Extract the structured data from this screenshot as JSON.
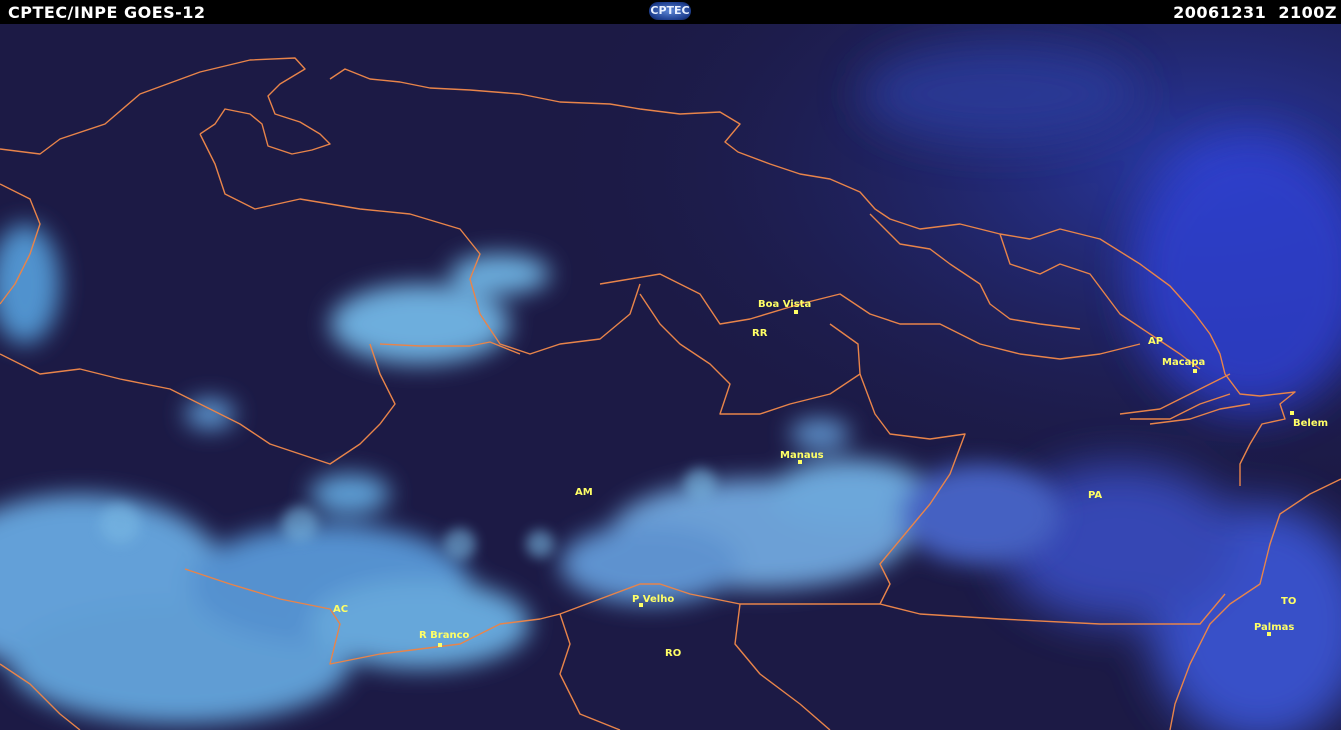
{
  "header": {
    "title": "CPTEC/INPE GOES-12",
    "datetime": "20061231  2100Z",
    "logo_text": "CPTEC"
  },
  "colors": {
    "background": "#1c1a45",
    "clouds": "#7ad0ff",
    "borders": "#e8844a",
    "labels": "#ffff66"
  },
  "cities": [
    {
      "id": "boa-vista",
      "name": "Boa Vista"
    },
    {
      "id": "macapa",
      "name": "Macapa"
    },
    {
      "id": "belem",
      "name": "Belem"
    },
    {
      "id": "manaus",
      "name": "Manaus"
    },
    {
      "id": "p-velho",
      "name": "P Velho"
    },
    {
      "id": "r-branco",
      "name": "R Branco"
    },
    {
      "id": "palmas",
      "name": "Palmas"
    }
  ],
  "states": [
    {
      "id": "rr",
      "name": "RR"
    },
    {
      "id": "ap",
      "name": "AP"
    },
    {
      "id": "am",
      "name": "AM"
    },
    {
      "id": "pa",
      "name": "PA"
    },
    {
      "id": "ac",
      "name": "AC"
    },
    {
      "id": "ro",
      "name": "RO"
    },
    {
      "id": "to",
      "name": "TO"
    }
  ]
}
